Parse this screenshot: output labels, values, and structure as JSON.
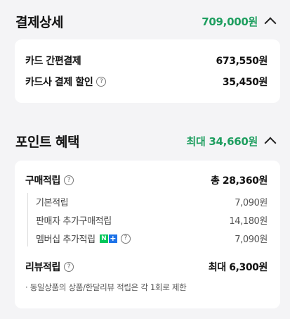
{
  "payment_detail": {
    "title": "결제상세",
    "total": "709,000원",
    "rows": [
      {
        "label": "카드 간편결제",
        "value": "673,550원"
      },
      {
        "label": "카드사 결제 할인",
        "value": "35,450원"
      }
    ]
  },
  "point_benefit": {
    "title": "포인트 혜택",
    "total": "최대 34,660원",
    "purchase": {
      "label": "구매적립",
      "value": "총 28,360원",
      "items": [
        {
          "label": "기본적립",
          "value": "7,090원"
        },
        {
          "label": "판매자 추가구매적립",
          "value": "14,180원"
        },
        {
          "label": "멤버십 추가적립",
          "value": "7,090원",
          "badge_n": "N",
          "badge_plus": "+"
        }
      ]
    },
    "review": {
      "label": "리뷰적립",
      "value": "최대 6,300원"
    },
    "note": "· 동일상품의 상품/한달리뷰 적립은 각 1회로 제한"
  },
  "icons": {
    "help": "?"
  },
  "colors": {
    "accent_green": "#1e9e5f",
    "npay_green": "#03c75a",
    "npay_blue": "#1e73e8"
  }
}
